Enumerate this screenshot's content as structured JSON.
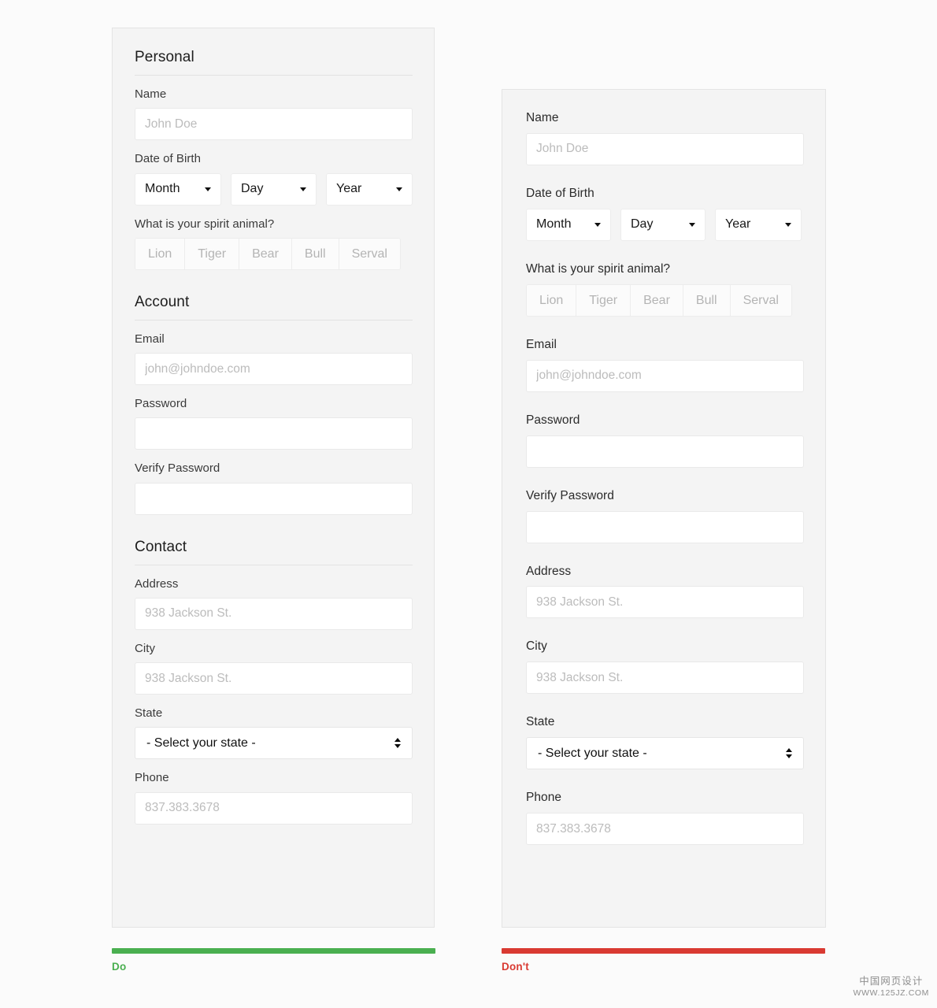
{
  "do_panel": {
    "sections": [
      {
        "heading": "Personal",
        "fields": [
          {
            "label": "Name",
            "type": "text",
            "placeholder": "John Doe",
            "value": ""
          },
          {
            "label": "Date of Birth",
            "type": "dob",
            "selects": [
              {
                "label": "Month"
              },
              {
                "label": "Day"
              },
              {
                "label": "Year"
              }
            ]
          },
          {
            "label": "What is your spirit animal?",
            "type": "segmented",
            "options": [
              "Lion",
              "Tiger",
              "Bear",
              "Bull",
              "Serval"
            ]
          }
        ]
      },
      {
        "heading": "Account",
        "fields": [
          {
            "label": "Email",
            "type": "text",
            "placeholder": "john@johndoe.com",
            "value": ""
          },
          {
            "label": "Password",
            "type": "password",
            "placeholder": "",
            "value": ""
          },
          {
            "label": "Verify Password",
            "type": "password",
            "placeholder": "",
            "value": ""
          }
        ]
      },
      {
        "heading": "Contact",
        "fields": [
          {
            "label": "Address",
            "type": "text",
            "placeholder": "938 Jackson St.",
            "value": ""
          },
          {
            "label": "City",
            "type": "text",
            "placeholder": "938 Jackson St.",
            "value": ""
          },
          {
            "label": "State",
            "type": "select",
            "selected": "- Select your state -"
          },
          {
            "label": "Phone",
            "type": "text",
            "placeholder": "837.383.3678",
            "value": ""
          }
        ]
      }
    ]
  },
  "dont_panel": {
    "fields": [
      {
        "label": "Name",
        "type": "text",
        "placeholder": "John Doe",
        "value": ""
      },
      {
        "label": "Date of Birth",
        "type": "dob",
        "selects": [
          {
            "label": "Month"
          },
          {
            "label": "Day"
          },
          {
            "label": "Year"
          }
        ]
      },
      {
        "label": "What is your spirit animal?",
        "type": "segmented",
        "options": [
          "Lion",
          "Tiger",
          "Bear",
          "Bull",
          "Serval"
        ]
      },
      {
        "label": "Email",
        "type": "text",
        "placeholder": "john@johndoe.com",
        "value": ""
      },
      {
        "label": "Password",
        "type": "password",
        "placeholder": "",
        "value": ""
      },
      {
        "label": "Verify Password",
        "type": "password",
        "placeholder": "",
        "value": ""
      },
      {
        "label": "Address",
        "type": "text",
        "placeholder": "938 Jackson St.",
        "value": ""
      },
      {
        "label": "City",
        "type": "text",
        "placeholder": "938 Jackson St.",
        "value": ""
      },
      {
        "label": "State",
        "type": "select",
        "selected": "- Select your state -"
      },
      {
        "label": "Phone",
        "type": "text",
        "placeholder": "837.383.3678",
        "value": ""
      }
    ]
  },
  "verdicts": {
    "do": {
      "caption": "Do",
      "color": "#4aaf50"
    },
    "dont": {
      "caption": "Don't",
      "color": "#d93a32"
    }
  },
  "watermark": {
    "line1": "中国网页设计",
    "line2": "WWW.125JZ.COM"
  }
}
